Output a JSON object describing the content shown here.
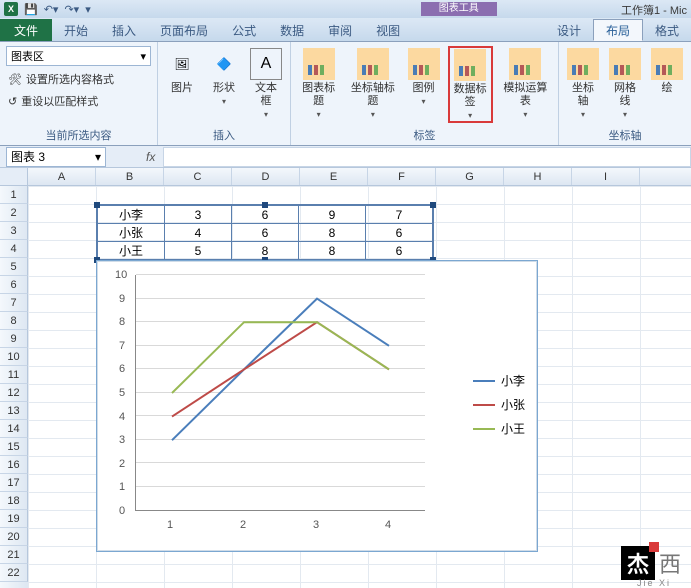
{
  "app": {
    "doc_title": "工作簿1 - Mic",
    "contextual_title": "图表工具"
  },
  "qat": {
    "save": "save-icon",
    "undo": "undo-icon",
    "redo": "redo-icon"
  },
  "tabs": {
    "file": "文件",
    "items": [
      "开始",
      "插入",
      "页面布局",
      "公式",
      "数据",
      "审阅",
      "视图"
    ],
    "ctx": [
      "设计",
      "布局",
      "格式"
    ],
    "active": "布局"
  },
  "ribbon": {
    "g1": {
      "dropdown": "图表区",
      "btn1": "设置所选内容格式",
      "btn2": "重设以匹配样式",
      "label": "当前所选内容"
    },
    "g2": {
      "b1": "图片",
      "b2": "形状",
      "b3": "文本框",
      "label": "插入"
    },
    "g3": {
      "b1": "图表标题",
      "b2": "坐标轴标题",
      "b3": "图例",
      "b4": "数据标签",
      "b5": "模拟运算表",
      "label": "标签"
    },
    "g4": {
      "b1": "坐标轴",
      "b2": "网格线",
      "b3": "绘",
      "label": "坐标轴"
    }
  },
  "namebox": "图表 3",
  "fx_label": "fx",
  "cols": [
    "A",
    "B",
    "C",
    "D",
    "E",
    "F",
    "G",
    "H",
    "I"
  ],
  "rows": [
    "1",
    "2",
    "3",
    "4",
    "5",
    "6",
    "7",
    "8",
    "9",
    "10",
    "11",
    "12",
    "13",
    "14",
    "15",
    "16",
    "17",
    "18",
    "19",
    "20",
    "21",
    "22"
  ],
  "table": {
    "r1": {
      "name": "小李",
      "c1": "3",
      "c2": "6",
      "c3": "9",
      "c4": "7"
    },
    "r2": {
      "name": "小张",
      "c1": "4",
      "c2": "6",
      "c3": "8",
      "c4": "6"
    },
    "r3": {
      "name": "小王",
      "c1": "5",
      "c2": "8",
      "c3": "8",
      "c4": "6"
    }
  },
  "chart_data": {
    "type": "line",
    "categories": [
      "1",
      "2",
      "3",
      "4"
    ],
    "series": [
      {
        "name": "小李",
        "values": [
          3,
          6,
          9,
          7
        ],
        "color": "#4a7ebb"
      },
      {
        "name": "小张",
        "values": [
          4,
          6,
          8,
          6
        ],
        "color": "#be4b48"
      },
      {
        "name": "小王",
        "values": [
          5,
          8,
          8,
          6
        ],
        "color": "#98b954"
      }
    ],
    "ylim": [
      0,
      10
    ],
    "yticks": [
      "0",
      "1",
      "2",
      "3",
      "4",
      "5",
      "6",
      "7",
      "8",
      "9",
      "10"
    ],
    "title": "",
    "xlabel": "",
    "ylabel": ""
  },
  "watermark": {
    "box": "杰",
    "text": "西",
    "sub": "Jie Xi"
  }
}
